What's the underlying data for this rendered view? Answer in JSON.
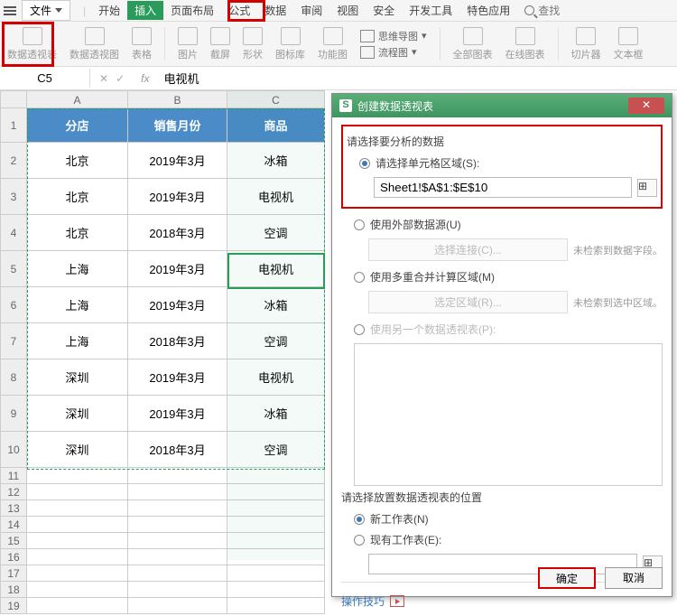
{
  "menubar": {
    "file": "文件",
    "items": [
      "开始",
      "插入",
      "页面布局",
      "公式",
      "数据",
      "审阅",
      "视图",
      "安全",
      "开发工具",
      "特色应用"
    ],
    "search": "查找"
  },
  "ribbon": {
    "pivot_table": "数据透视表",
    "pivot_chart": "数据透视图",
    "table": "表格",
    "picture": "图片",
    "screenshot": "截屏",
    "shapes": "形状",
    "icons": "图标库",
    "smartart": "功能图",
    "mindmap": "思维导图",
    "flowchart": "流程图",
    "all_charts": "全部图表",
    "online_chart": "在线图表",
    "slicer": "切片器",
    "textbox": "文本框"
  },
  "formula": {
    "namebox": "C5",
    "value": "电视机"
  },
  "cols": [
    "A",
    "B",
    "C"
  ],
  "headers": {
    "a": "分店",
    "b": "销售月份",
    "c": "商品"
  },
  "rows": [
    {
      "a": "北京",
      "b": "2019年3月",
      "c": "冰箱"
    },
    {
      "a": "北京",
      "b": "2019年3月",
      "c": "电视机"
    },
    {
      "a": "北京",
      "b": "2018年3月",
      "c": "空调"
    },
    {
      "a": "上海",
      "b": "2019年3月",
      "c": "电视机"
    },
    {
      "a": "上海",
      "b": "2019年3月",
      "c": "冰箱"
    },
    {
      "a": "上海",
      "b": "2018年3月",
      "c": "空调"
    },
    {
      "a": "深圳",
      "b": "2019年3月",
      "c": "电视机"
    },
    {
      "a": "深圳",
      "b": "2019年3月",
      "c": "冰箱"
    },
    {
      "a": "深圳",
      "b": "2018年3月",
      "c": "空调"
    }
  ],
  "dialog": {
    "title": "创建数据透视表",
    "grp1": "请选择要分析的数据",
    "opt_range": "请选择单元格区域(S):",
    "range_value": "Sheet1!$A$1:$E$10",
    "opt_ext": "使用外部数据源(U)",
    "ext_btn": "选择连接(C)...",
    "ext_info": "未检索到数据字段。",
    "opt_multi": "使用多重合并计算区域(M)",
    "multi_btn": "选定区域(R)...",
    "multi_info": "未检索到选中区域。",
    "opt_another": "使用另一个数据透视表(P):",
    "grp2": "请选择放置数据透视表的位置",
    "opt_new": "新工作表(N)",
    "opt_exist": "现有工作表(E):",
    "tips": "操作技巧",
    "ok": "确定",
    "cancel": "取消"
  }
}
